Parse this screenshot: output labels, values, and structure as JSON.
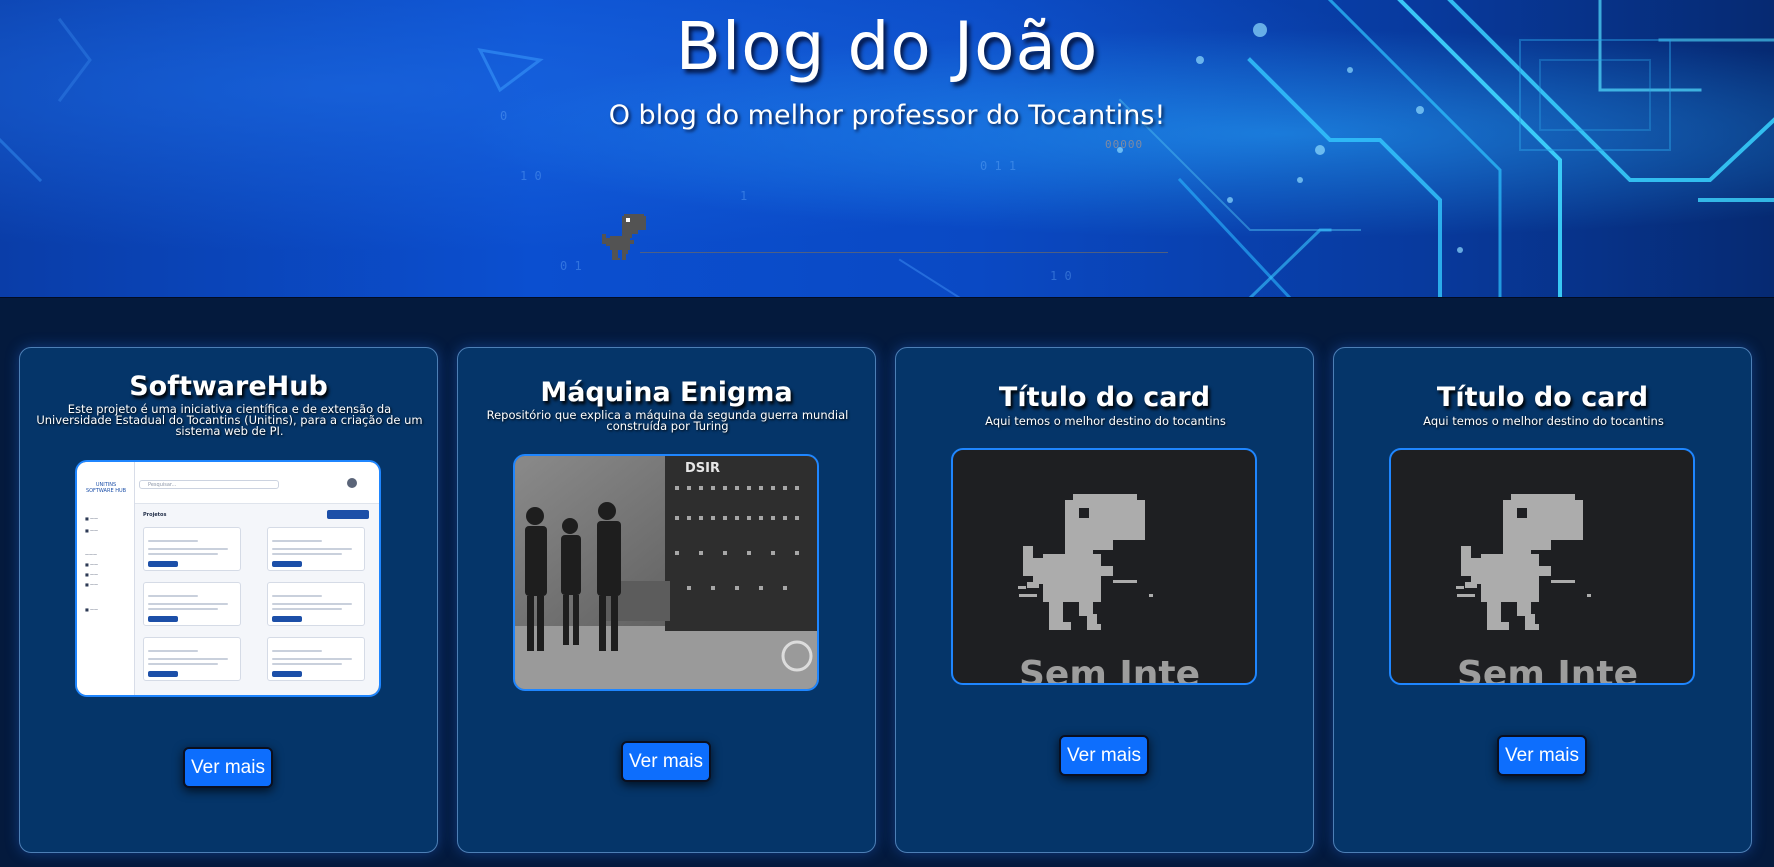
{
  "hero": {
    "title": "Blog do João",
    "subtitle": "O blog do melhor professor do Tocantins!",
    "score": "00000"
  },
  "cards": [
    {
      "title": "SoftwareHub",
      "description": "Este projeto é uma iniciativa científica e de extensão da Universidade Estadual do Tocantins (Unitins), para a criação de um sistema web de PI.",
      "button_label": "Ver mais",
      "preview": {
        "logo_top": "UNITINS",
        "logo_bottom": "SOFTWARE HUB",
        "search_placeholder": "Pesquisar...",
        "section_title": "Projetos"
      }
    },
    {
      "title": "Máquina Enigma",
      "description": "Repositório que explica a máquina da segunda guerra mundial construída por Turing",
      "button_label": "Ver mais",
      "image_caption": "DSIR"
    },
    {
      "title": "Título do card",
      "description": "Aqui temos o melhor destino do tocantins",
      "button_label": "Ver mais",
      "offline_text": "Sem Inte"
    },
    {
      "title": "Título do card",
      "description": "Aqui temos o melhor destino do tocantins",
      "button_label": "Ver mais",
      "offline_text": "Sem Inte"
    }
  ],
  "colors": {
    "background": "#041a3d",
    "card": "#053569",
    "button": "#0d6efd",
    "accent_border": "#1f86ff"
  }
}
